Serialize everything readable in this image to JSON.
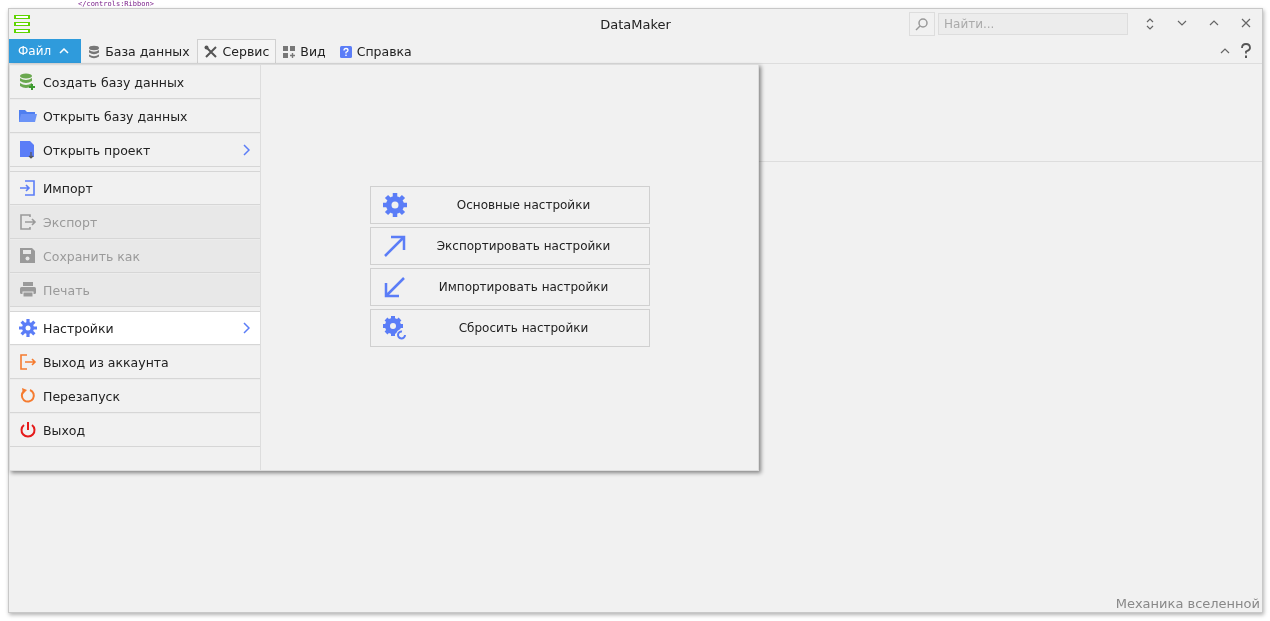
{
  "background_editor": {
    "lines": [
      "</controls:Ribbon>"
    ]
  },
  "window": {
    "title": "DataMaker"
  },
  "search": {
    "placeholder": "Найти..."
  },
  "ribbon": {
    "app_button": {
      "label": "Файл",
      "expanded": true
    },
    "tabs": [
      {
        "label": "База данных",
        "selected": false
      },
      {
        "label": "Сервис",
        "selected": true
      },
      {
        "label": "Вид",
        "selected": false
      },
      {
        "label": "Справка",
        "selected": false
      }
    ]
  },
  "file_menu": {
    "items": [
      {
        "label": "Создать базу данных",
        "disabled": false,
        "selected": false,
        "submenu": false
      },
      {
        "label": "Открыть базу данных",
        "disabled": false,
        "selected": false,
        "submenu": false
      },
      {
        "label": "Открыть проект",
        "disabled": false,
        "selected": false,
        "submenu": true
      },
      {
        "label": "Импорт",
        "disabled": false,
        "selected": false,
        "submenu": false
      },
      {
        "label": "Экспорт",
        "disabled": true,
        "selected": false,
        "submenu": false
      },
      {
        "label": "Сохранить как",
        "disabled": true,
        "selected": false,
        "submenu": false
      },
      {
        "label": "Печать",
        "disabled": true,
        "selected": false,
        "submenu": false
      },
      {
        "label": "Настройки",
        "disabled": false,
        "selected": true,
        "submenu": true
      },
      {
        "label": "Выход из аккаунта",
        "disabled": false,
        "selected": false,
        "submenu": false
      },
      {
        "label": "Перезапуск",
        "disabled": false,
        "selected": false,
        "submenu": false
      },
      {
        "label": "Выход",
        "disabled": false,
        "selected": false,
        "submenu": false
      }
    ],
    "settings_buttons": [
      "Основные настройки",
      "Экспортировать настройки",
      "Импортировать настройки",
      "Сбросить настройки"
    ]
  },
  "status_bar": {
    "text": "Механика вселенной"
  }
}
